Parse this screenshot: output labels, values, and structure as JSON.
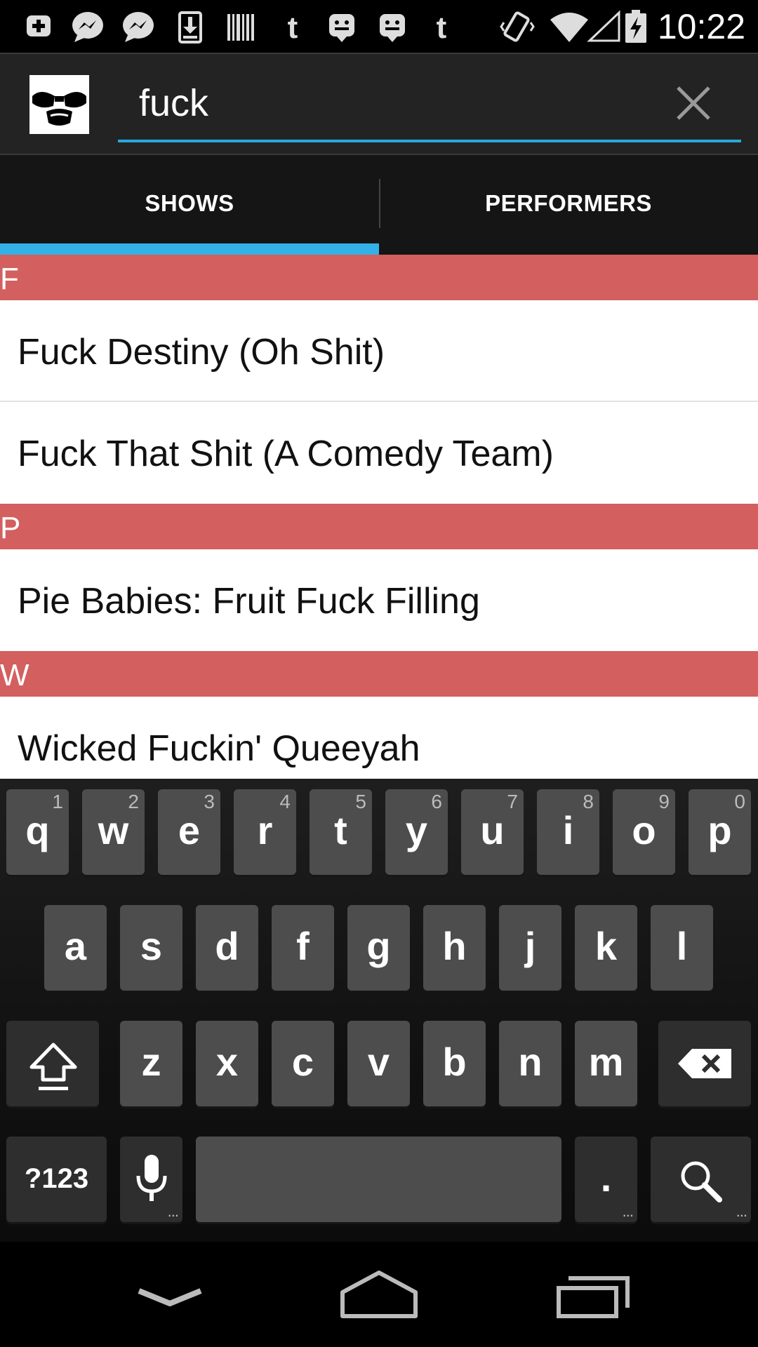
{
  "status_bar": {
    "time": "10:22",
    "icons": [
      "plus-box-icon",
      "messenger-icon",
      "messenger-icon",
      "download-icon",
      "barcode-icon",
      "tumblr-icon",
      "bbm-icon",
      "bbm-icon",
      "tumblr-icon",
      "vibrate-icon",
      "wifi-icon",
      "cell-signal-icon",
      "battery-charging-icon"
    ]
  },
  "action_bar": {
    "search_value": "fuck",
    "clear_icon": "close-icon"
  },
  "tabs": [
    {
      "label": "SHOWS",
      "selected": true
    },
    {
      "label": "PERFORMERS",
      "selected": false
    }
  ],
  "colors": {
    "accent": "#32b2e6",
    "section_header": "#d35f5f",
    "action_bar": "#232323"
  },
  "results": {
    "sections": [
      {
        "letter": "F",
        "items": [
          "Fuck Destiny (Oh Shit)",
          "Fuck That Shit (A Comedy Team)"
        ]
      },
      {
        "letter": "P",
        "items": [
          "Pie Babies: Fruit Fuck Filling"
        ]
      },
      {
        "letter": "W",
        "items": [
          "Wicked Fuckin' Queeyah"
        ]
      }
    ]
  },
  "keyboard": {
    "row1": [
      {
        "c": "q",
        "h": "1"
      },
      {
        "c": "w",
        "h": "2"
      },
      {
        "c": "e",
        "h": "3"
      },
      {
        "c": "r",
        "h": "4"
      },
      {
        "c": "t",
        "h": "5"
      },
      {
        "c": "y",
        "h": "6"
      },
      {
        "c": "u",
        "h": "7"
      },
      {
        "c": "i",
        "h": "8"
      },
      {
        "c": "o",
        "h": "9"
      },
      {
        "c": "p",
        "h": "0"
      }
    ],
    "row2": [
      "a",
      "s",
      "d",
      "f",
      "g",
      "h",
      "j",
      "k",
      "l"
    ],
    "row3": [
      "z",
      "x",
      "c",
      "v",
      "b",
      "n",
      "m"
    ],
    "symbols_label": "?123",
    "period_label": ".",
    "shift_icon": "shift-icon",
    "backspace_icon": "backspace-icon",
    "mic_icon": "microphone-icon",
    "search_icon": "search-icon"
  },
  "nav_bar": {
    "icons": [
      "hide-keyboard-icon",
      "home-icon",
      "recent-apps-icon"
    ]
  }
}
